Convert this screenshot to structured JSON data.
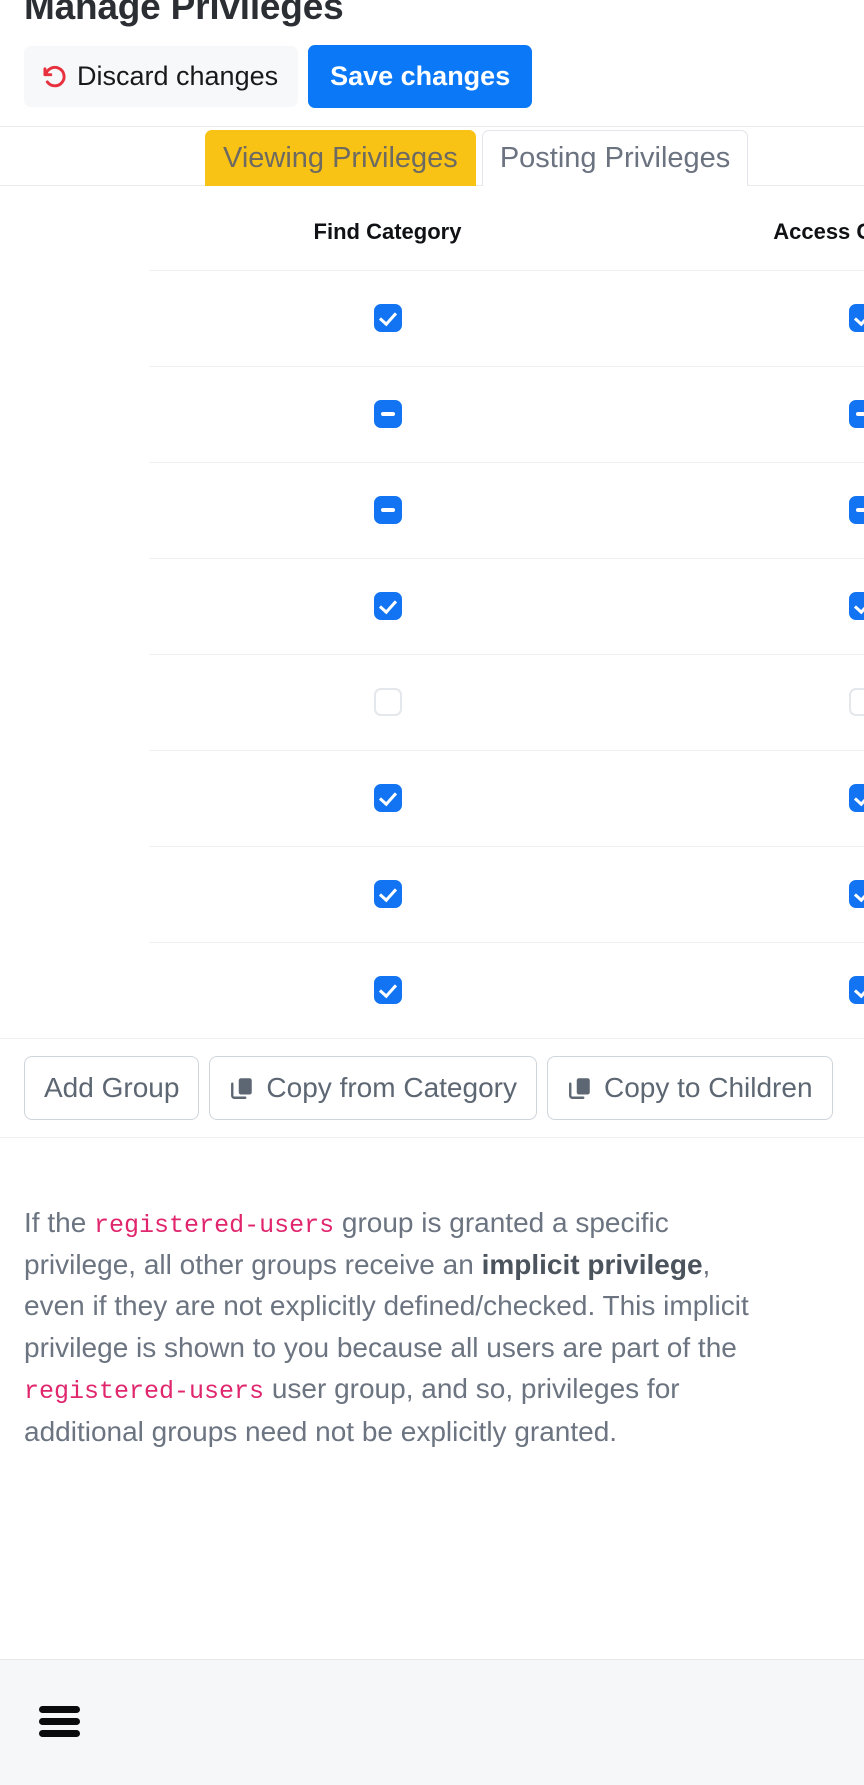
{
  "header": {
    "title": "Manage Privileges",
    "discard_label": "Discard changes",
    "save_label": "Save changes",
    "discard_icon": "undo-icon",
    "accent_blue": "#0b79f7",
    "discard_icon_color": "#e8313f"
  },
  "tabs": {
    "active_index": 0,
    "active_color": "#f9c316",
    "items": [
      {
        "label": "Viewing Privileges",
        "active": true
      },
      {
        "label": "Posting Privileges",
        "active": false
      }
    ]
  },
  "table": {
    "columns": [
      "Find Category",
      "Access Category"
    ],
    "rows": [
      {
        "find": "checked",
        "access": "checked"
      },
      {
        "find": "indeterminate",
        "access": "indeterminate"
      },
      {
        "find": "indeterminate",
        "access": "indeterminate"
      },
      {
        "find": "checked",
        "access": "checked"
      },
      {
        "find": "unchecked",
        "access": "unchecked"
      },
      {
        "find": "checked",
        "access": "checked"
      },
      {
        "find": "checked",
        "access": "checked"
      },
      {
        "find": "checked",
        "access": "checked"
      }
    ],
    "checked_color": "#1274f3"
  },
  "actions": {
    "add_group": "Add Group",
    "copy_from_category": "Copy from Category",
    "copy_to_children": "Copy to Children",
    "copy_icon": "copy-icon"
  },
  "description": {
    "part1": "If the ",
    "code1": "registered-users",
    "part2": " group is granted a specific privilege, all other groups receive an ",
    "bold1": "implicit privilege",
    "part3": ", even if they are not explicitly defined/checked. This implicit privilege is shown to you because all users are part of the ",
    "code2": "registered-users",
    "part4": " user group, and so, privileges for additional groups need not be explicitly granted.",
    "code_color": "#e0266d"
  },
  "bottom_bar": {
    "menu_icon": "hamburger-menu-icon",
    "background": "#f5f7f9"
  }
}
